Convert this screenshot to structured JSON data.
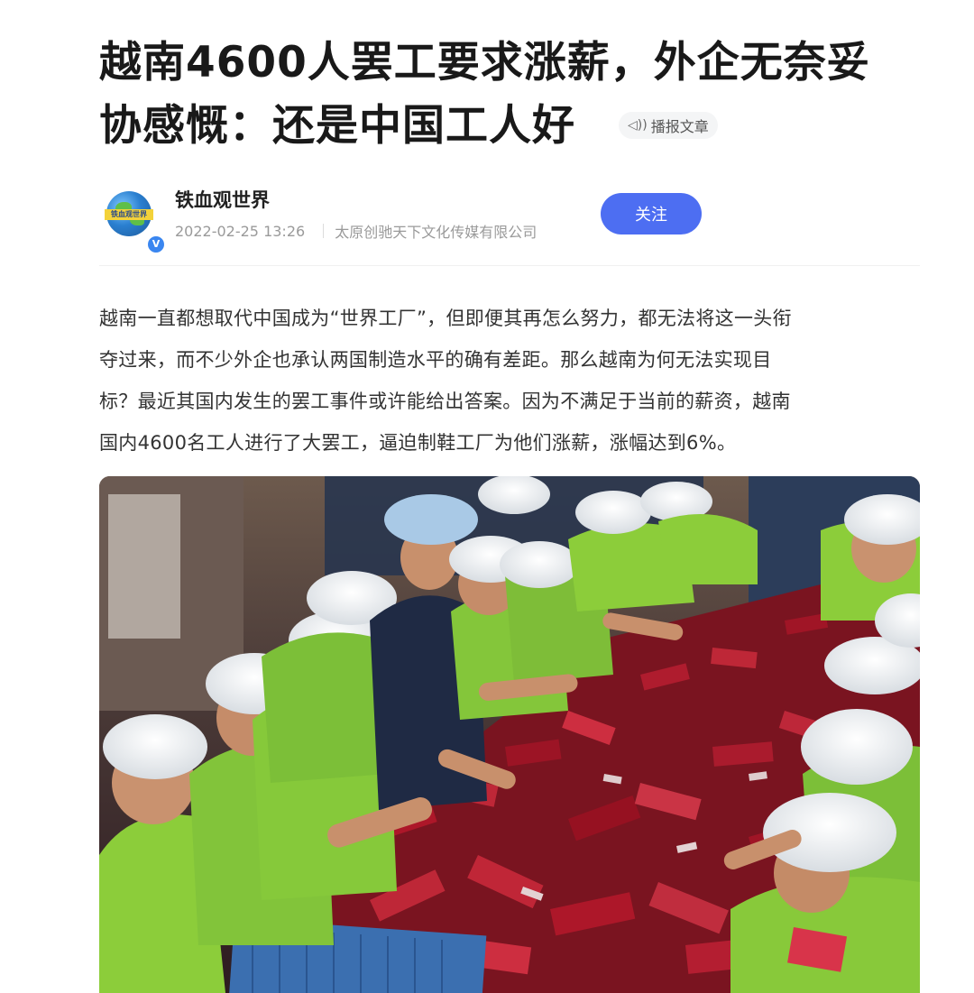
{
  "article": {
    "title_line1": "越南4600人罢工要求涨薪，外企无奈妥",
    "title_line2": "协感慨：还是中国工人好",
    "listen_label": "播报文章",
    "listen_icon": "speaker-icon"
  },
  "author": {
    "name": "铁血观世界",
    "avatar_text": "铁血观世界",
    "verified_mark": "V",
    "date": "2022-02-25 13:26",
    "source": "太原创驰天下文化传媒有限公司",
    "follow_label": "关注"
  },
  "body": {
    "paragraph_lines": [
      "越南一直都想取代中国成为“世界工厂”，但即便其再怎么努力，都无法将这一头衔",
      "夺过来，而不少外企也承认两国制造水平的确有差距。那么越南为何无法实现目",
      "标？最近其国内发生的罢工事件或许能给出答案。因为不满足于当前的薪资，越南",
      "国内4600名工人进行了大罢工，逼迫制鞋工厂为他们涨薪，涨幅达到6%。"
    ]
  },
  "photo": {
    "subject": "factory-workers-photo"
  },
  "colors": {
    "accent": "#4d6ef2",
    "meta": "#9a9a9a",
    "shirt_green": "#8ccd3a"
  }
}
